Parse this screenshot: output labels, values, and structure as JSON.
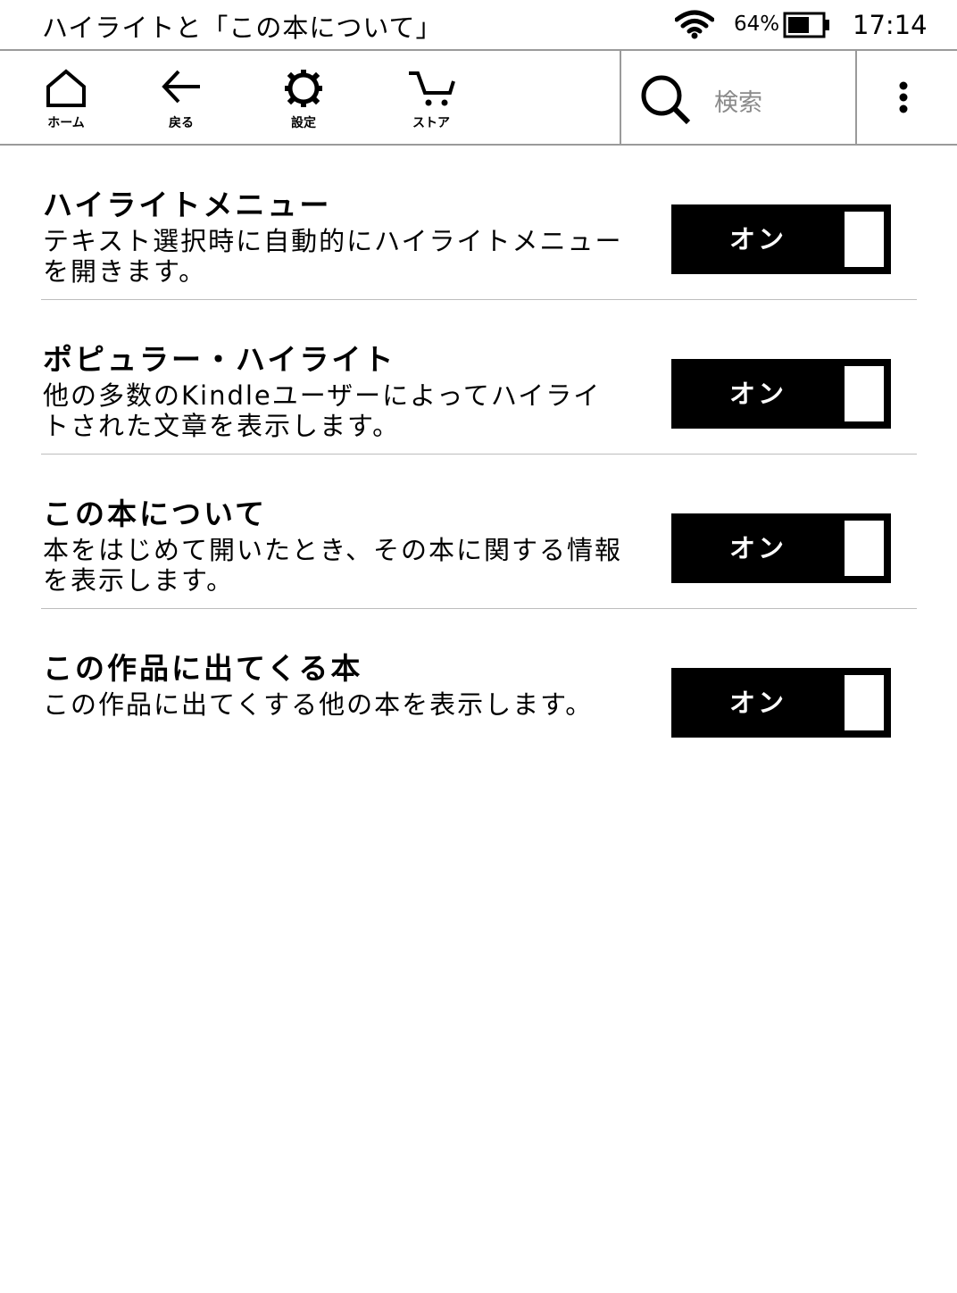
{
  "status_bar": {
    "title": "ハイライトと「この本について」",
    "battery_percent": "64%",
    "battery_level": 0.64,
    "time": "17:14",
    "wifi_icon": "wifi-icon",
    "battery_icon": "battery-icon"
  },
  "toolbar": {
    "home_label": "ホーム",
    "back_label": "戻る",
    "settings_label": "設定",
    "store_label": "ストア",
    "search_placeholder": "検索",
    "icons": [
      "home-icon",
      "back-arrow-icon",
      "gear-icon",
      "cart-icon",
      "search-icon",
      "more-vertical-icon"
    ]
  },
  "settings": [
    {
      "title": "ハイライトメニュー",
      "description": "テキスト選択時に自動的にハイライトメニューを開きます。",
      "toggle_label": "オン",
      "enabled": true
    },
    {
      "title": "ポピュラー・ハイライト",
      "description": "他の多数のKindleユーザーによってハイライトされた文章を表示します。",
      "toggle_label": "オン",
      "enabled": true
    },
    {
      "title": "この本について",
      "description": "本をはじめて開いたとき、その本に関する情報を表示します。",
      "toggle_label": "オン",
      "enabled": true
    },
    {
      "title": "この作品に出てくる本",
      "description": "この作品に出てくする他の本を表示します。",
      "toggle_label": "オン",
      "enabled": true
    }
  ]
}
